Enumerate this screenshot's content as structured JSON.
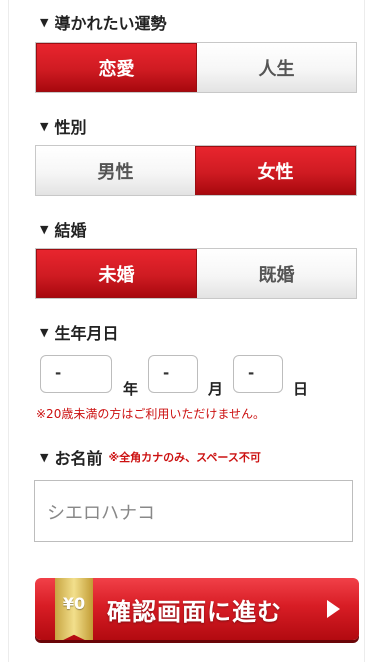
{
  "fortune": {
    "label": "導かれたい運勢",
    "options": [
      "恋愛",
      "人生"
    ],
    "selected": "恋愛"
  },
  "gender": {
    "label": "性別",
    "options": [
      "男性",
      "女性"
    ],
    "selected": "女性"
  },
  "marriage": {
    "label": "結婚",
    "options": [
      "未婚",
      "既婚"
    ],
    "selected": "未婚"
  },
  "birthdate": {
    "label": "生年月日",
    "year_value": "-",
    "month_value": "-",
    "day_value": "-",
    "year_unit": "年",
    "month_unit": "月",
    "day_unit": "日",
    "note": "※20歳未満の方はご利用いただけません。"
  },
  "name": {
    "label": "お名前",
    "note": "※全角カナのみ、スペース不可",
    "placeholder": "シエロハナコ"
  },
  "submit": {
    "badge": "¥0",
    "label": "確認画面に進む"
  },
  "colors": {
    "accent_red": "#cf1b22",
    "note_red": "#cc1111",
    "badge_gold": "#f2df8c"
  }
}
